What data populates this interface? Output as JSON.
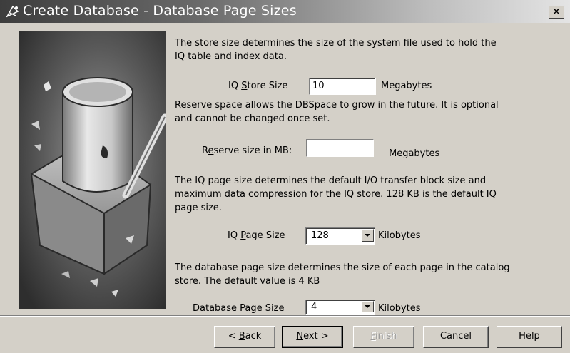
{
  "window": {
    "title": "Create Database - Database Page Sizes",
    "close_glyph": "×"
  },
  "intro_text": [
    "The store size determines the size of the system file used to hold the",
    "IQ table and index data."
  ],
  "iq_store_size": {
    "label_pre": "IQ ",
    "label_key": "S",
    "label_post": "tore Size",
    "value": "10",
    "unit": "Megabytes"
  },
  "reserve_text": [
    "Reserve space allows the DBSpace to grow in the future.  It is optional",
    "and cannot be changed once set."
  ],
  "reserve_size": {
    "label_pre": "R",
    "label_key": "e",
    "label_post": "serve size in MB:",
    "value": "",
    "unit": "Megabytes"
  },
  "iq_page_text": [
    "The IQ page size determines the default I/O transfer block size and",
    "maximum data compression for the IQ store.  128 KB is the default IQ",
    "page size."
  ],
  "iq_page_size": {
    "label_pre": "IQ ",
    "label_key": "P",
    "label_post": "age Size",
    "value": "128",
    "unit": "Kilobytes"
  },
  "db_page_text": [
    "The database page size determines the size of each page in the catalog",
    "store.  The default value is 4 KB"
  ],
  "db_page_size": {
    "label_pre": "",
    "label_key": "D",
    "label_post": "atabase Page Size",
    "value": "4",
    "unit": "Kilobytes"
  },
  "buttons": {
    "back": {
      "pre": "< ",
      "key": "B",
      "post": "ack"
    },
    "next": {
      "pre": "",
      "key": "N",
      "post": "ext >"
    },
    "finish": {
      "pre": "",
      "key": "F",
      "post": "inish"
    },
    "cancel": "Cancel",
    "help": "Help"
  }
}
